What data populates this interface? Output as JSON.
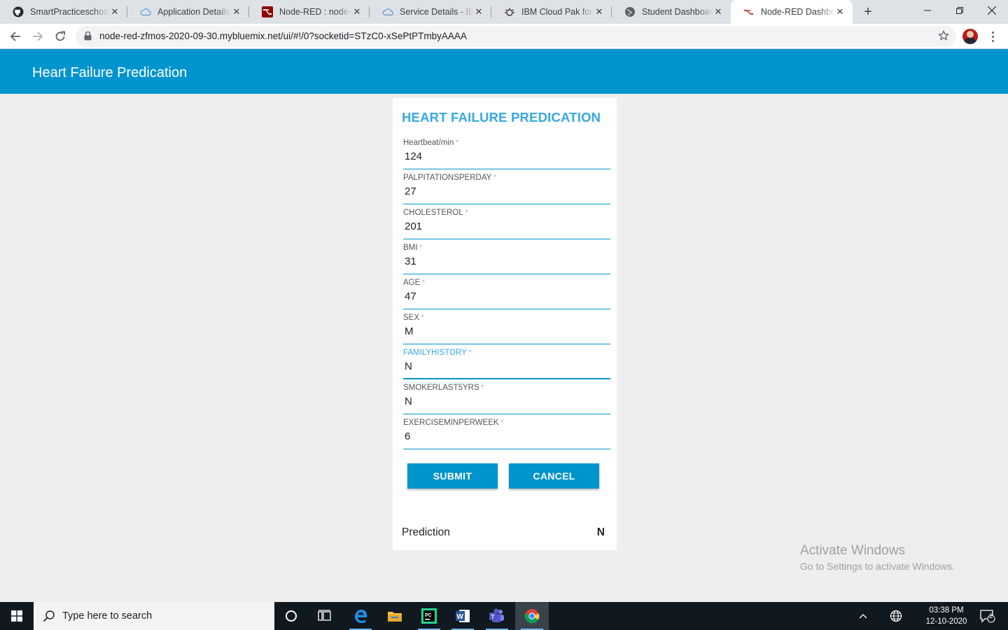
{
  "browser": {
    "tabs": [
      {
        "title": "SmartPracticeschool",
        "icon": "github-icon"
      },
      {
        "title": "Application Details -",
        "icon": "cloud-icon"
      },
      {
        "title": "Node-RED : node-re",
        "icon": "node-red-icon"
      },
      {
        "title": "Service Details - IBM",
        "icon": "cloud-icon"
      },
      {
        "title": "IBM Cloud Pak for D",
        "icon": "gear-bulb-icon"
      },
      {
        "title": "Student Dashboard",
        "icon": "globe-icon"
      },
      {
        "title": "Node-RED Dashboa",
        "icon": "node-red-icon",
        "active": true
      }
    ],
    "url": "node-red-zfmos-2020-09-30.mybluemix.net/ui/#!/0?socketid=STzC0-xSePtPTmbyAAAA"
  },
  "app": {
    "title": "Heart Failure Predication",
    "accent_color": "#0094ce"
  },
  "form": {
    "title": "HEART FAILURE PREDICATION",
    "required_mark": "*",
    "fields": [
      {
        "label": "Heartbeat/min",
        "value": "124"
      },
      {
        "label": "PALPITATIONSPERDAY",
        "value": "27"
      },
      {
        "label": "CHOLESTEROL",
        "value": "201"
      },
      {
        "label": "BMI",
        "value": "31"
      },
      {
        "label": "AGE",
        "value": "47"
      },
      {
        "label": "SEX",
        "value": "M"
      },
      {
        "label": "FAMILYHISTORY",
        "value": "N",
        "focused": true
      },
      {
        "label": "SMOKERLAST5YRS",
        "value": "N"
      },
      {
        "label": "EXERCISEMINPERWEEK",
        "value": "6"
      }
    ],
    "submit_label": "SUBMIT",
    "cancel_label": "CANCEL"
  },
  "prediction": {
    "label": "Prediction",
    "value": "N"
  },
  "watermark": {
    "line1": "Activate Windows",
    "line2": "Go to Settings to activate Windows."
  },
  "taskbar": {
    "search_placeholder": "Type here to search",
    "time": "03:38 PM",
    "date": "12-10-2020",
    "notification_count": "2"
  }
}
